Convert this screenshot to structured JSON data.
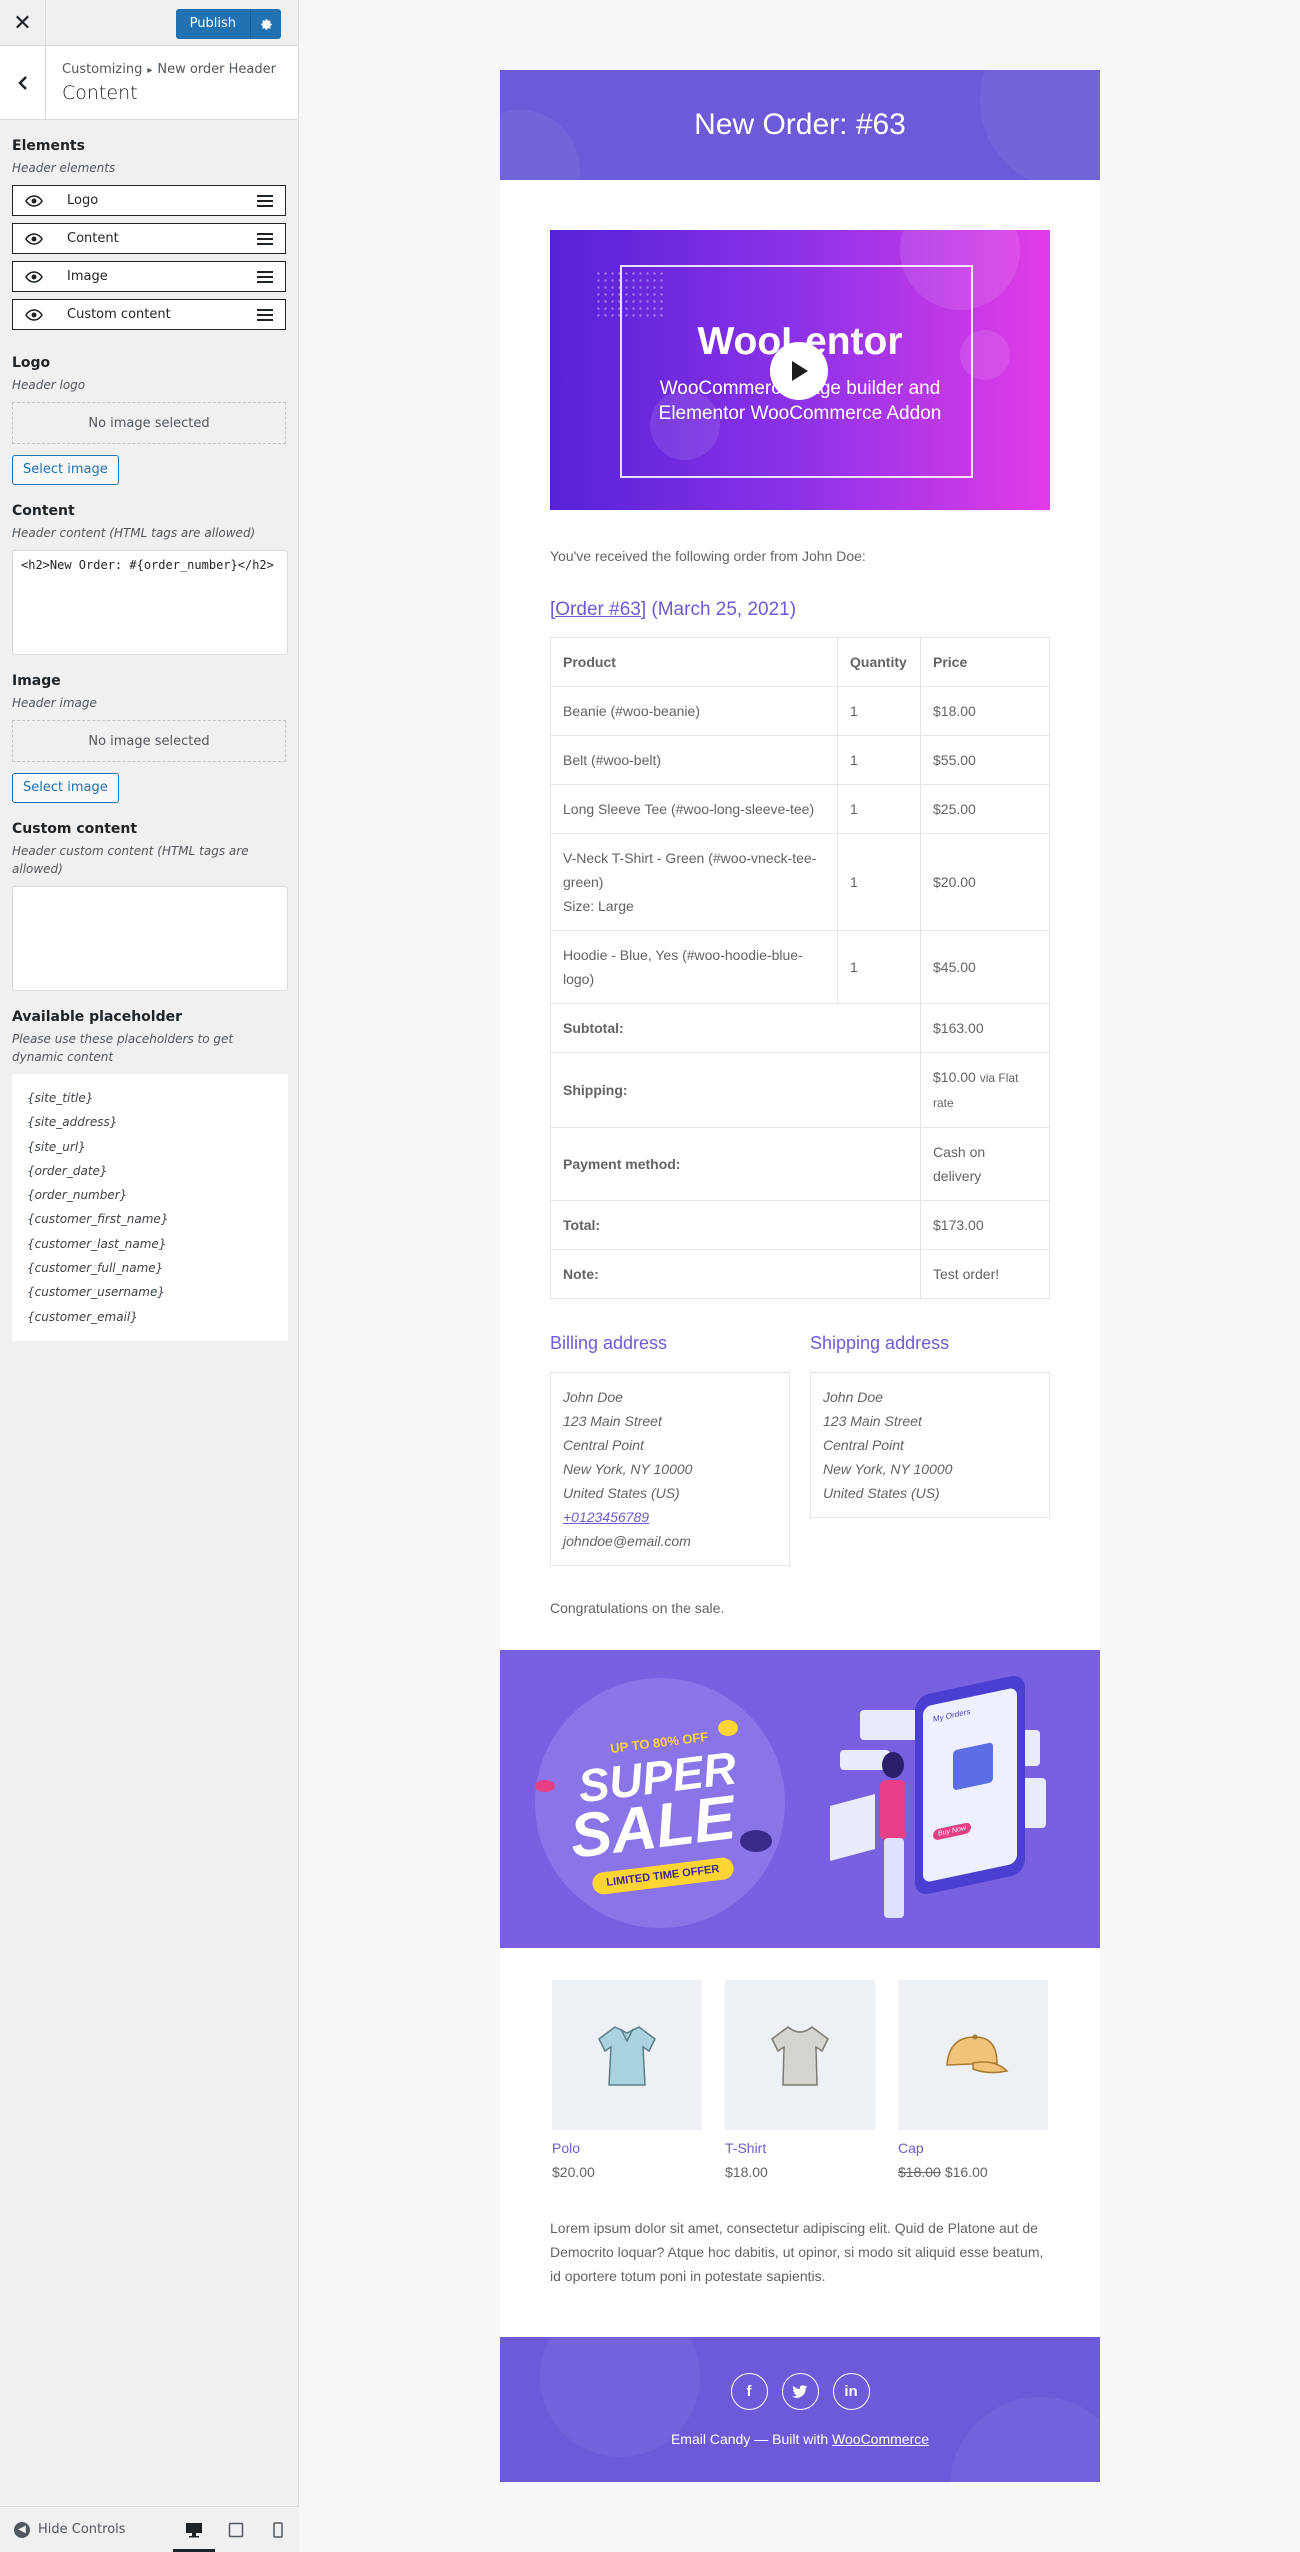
{
  "sidebar": {
    "close_glyph": "✕",
    "publish_label": "Publish",
    "breadcrumb_root": "Customizing",
    "breadcrumb_sep": "▸",
    "breadcrumb_current": "New order Header",
    "section_title": "Content",
    "elements": {
      "title": "Elements",
      "desc": "Header elements",
      "items": [
        {
          "label": "Logo"
        },
        {
          "label": "Content"
        },
        {
          "label": "Image"
        },
        {
          "label": "Custom content"
        }
      ]
    },
    "logo": {
      "title": "Logo",
      "desc": "Header logo",
      "no_image": "No image selected",
      "select_label": "Select image"
    },
    "content": {
      "title": "Content",
      "desc": "Header content (HTML tags are allowed)",
      "value": "<h2>New Order: #{order_number}</h2>"
    },
    "image": {
      "title": "Image",
      "desc": "Header image",
      "no_image": "No image selected",
      "select_label": "Select image"
    },
    "custom_content": {
      "title": "Custom content",
      "desc": "Header custom content (HTML tags are allowed)",
      "value": ""
    },
    "placeholders": {
      "title": "Available placeholder",
      "desc": "Please use these placeholders to get dynamic content",
      "items": [
        "{site_title}",
        "{site_address}",
        "{site_url}",
        "{order_date}",
        "{order_number}",
        "{customer_first_name}",
        "{customer_last_name}",
        "{customer_full_name}",
        "{customer_username}",
        "{customer_email}"
      ]
    },
    "footer": {
      "hide_controls": "Hide Controls"
    }
  },
  "email": {
    "header_title": "New Order: #63",
    "hero": {
      "title": "WooLentor",
      "subtitle_line1": "WooCommerce Page builder and",
      "subtitle_line2": "Elementor WooCommerce Addon"
    },
    "intro": "You've received the following order from John Doe:",
    "order_link": "[Order #63]",
    "order_date": "(March 25, 2021)",
    "table": {
      "headers": [
        "Product",
        "Quantity",
        "Price"
      ],
      "rows": [
        {
          "product": "Beanie (#woo-beanie)",
          "meta": "",
          "qty": "1",
          "price": "$18.00"
        },
        {
          "product": "Belt (#woo-belt)",
          "meta": "",
          "qty": "1",
          "price": "$55.00"
        },
        {
          "product": "Long Sleeve Tee (#woo-long-sleeve-tee)",
          "meta": "",
          "qty": "1",
          "price": "$25.00"
        },
        {
          "product": "V-Neck T-Shirt - Green (#woo-vneck-tee-green)",
          "meta": "Size: Large",
          "qty": "1",
          "price": "$20.00"
        },
        {
          "product": "Hoodie - Blue, Yes (#woo-hoodie-blue-logo)",
          "meta": "",
          "qty": "1",
          "price": "$45.00"
        }
      ],
      "totals": [
        {
          "label": "Subtotal:",
          "value": "$163.00",
          "note": ""
        },
        {
          "label": "Shipping:",
          "value": "$10.00",
          "note": "via Flat rate"
        },
        {
          "label": "Payment method:",
          "value": "Cash on delivery",
          "note": ""
        },
        {
          "label": "Total:",
          "value": "$173.00",
          "note": ""
        },
        {
          "label": "Note:",
          "value": "Test order!",
          "note": ""
        }
      ]
    },
    "billing": {
      "title": "Billing address",
      "lines": [
        "John Doe",
        "123 Main Street",
        "Central Point",
        "New York, NY 10000",
        "United States (US)"
      ],
      "phone": "+0123456789",
      "email": "johndoe@email.com"
    },
    "shipping": {
      "title": "Shipping address",
      "lines": [
        "John Doe",
        "123 Main Street",
        "Central Point",
        "New York, NY 10000",
        "United States (US)"
      ]
    },
    "congrats": "Congratulations on the sale.",
    "sale": {
      "upto": "UP TO 80% OFF",
      "super": "SUPER",
      "sale": "SALE",
      "limited": "LIMITED TIME OFFER",
      "phone_title": "My Orders",
      "buy_now": "Buy Now"
    },
    "products": [
      {
        "name": "Polo",
        "old_price": "",
        "price": "$20.00",
        "color": "#a9d3de"
      },
      {
        "name": "T-Shirt",
        "old_price": "",
        "price": "$18.00",
        "color": "#d6d4cf"
      },
      {
        "name": "Cap",
        "old_price": "$18.00",
        "price": "$16.00",
        "color": "#f0c27a"
      }
    ],
    "lorem": "Lorem ipsum dolor sit amet, consectetur adipiscing elit. Quid de Platone aut de Democrito loquar? Atque hoc dabitis, ut opinor, si modo sit aliquid esse beatum, id oportere totum poni in potestate sapientis.",
    "footer": {
      "social": [
        "f",
        "t",
        "in"
      ],
      "credit_prefix": "Email Candy — Built with ",
      "credit_link": "WooCommerce"
    }
  },
  "colors": {
    "accent": "#6c5bd8",
    "publish": "#2271b1",
    "sale_bg": "#7960e0"
  }
}
